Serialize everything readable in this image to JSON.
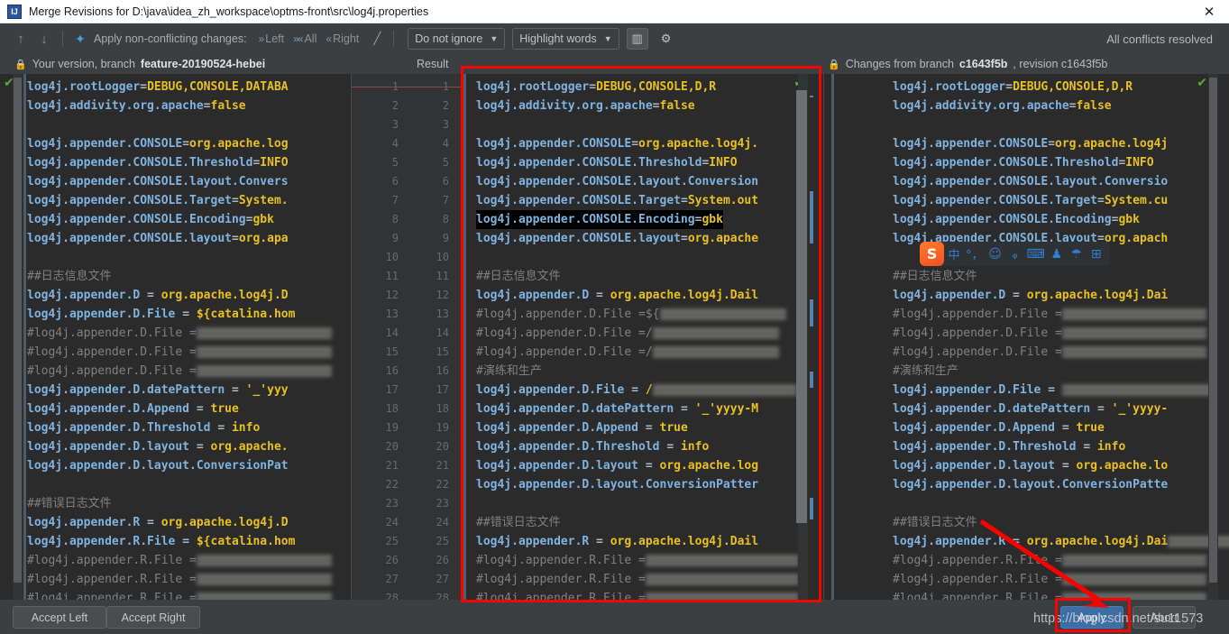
{
  "window": {
    "title": "Merge Revisions for D:\\java\\idea_zh_workspace\\optms-front\\src\\log4j.properties",
    "app_icon": "IJ",
    "close_icon": "✕"
  },
  "toolbar": {
    "prev_icon": "↑",
    "next_icon": "↓",
    "magic_icon": "✦",
    "apply_label": "Apply non-conflicting changes:",
    "left_label": "Left",
    "all_label": "All",
    "right_label": "Right",
    "left_icon": "»",
    "all_icon": "»«",
    "right_icon": "«",
    "wand_icon": "╱",
    "ignore_select": "Do not ignore",
    "highlight_select": "Highlight words",
    "caret_icon": "▼",
    "columns_icon": "▥",
    "gear_icon": "⚙",
    "status": "All conflicts resolved"
  },
  "headers": {
    "lock_icon": "🔒",
    "left_prefix": "Your version, branch ",
    "left_branch": "feature-20190524-hebei",
    "middle": "Result",
    "right_prefix": "Changes from branch ",
    "right_branch": "c1643f5b",
    "right_suffix": ", revision c1643f5b"
  },
  "editor": {
    "check_icon": "✔",
    "line_numbers_a": [
      "1",
      "2",
      "3",
      "4",
      "5",
      "6",
      "7",
      "8",
      "9",
      "10",
      "11",
      "12",
      "13",
      "14",
      "15",
      "16",
      "17",
      "18",
      "19",
      "20",
      "21",
      "22",
      "23",
      "24",
      "25",
      "26",
      "27",
      "28"
    ],
    "line_numbers_b": [
      "1",
      "2",
      "3",
      "4",
      "5",
      "6",
      "7",
      "8",
      "9",
      "10",
      "11",
      "12",
      "13",
      "14",
      "15",
      "16",
      "17",
      "18",
      "19",
      "20",
      "21",
      "22",
      "23",
      "24",
      "25",
      "26",
      "27",
      "28"
    ],
    "left_lines": [
      "log4j.rootLogger=DEBUG,CONSOLE,DATABA",
      "log4j.addivity.org.apache=false",
      "",
      "log4j.appender.CONSOLE=org.apache.log",
      "log4j.appender.CONSOLE.Threshold=INFO",
      "log4j.appender.CONSOLE.layout.Convers",
      "log4j.appender.CONSOLE.Target=System.",
      "log4j.appender.CONSOLE.Encoding=gbk",
      "log4j.appender.CONSOLE.layout=org.apa",
      "",
      "##日志信息文件",
      "log4j.appender.D = org.apache.log4j.D",
      "log4j.appender.D.File =${catalina.hom",
      "#log4j.appender.D.File =",
      "#log4j.appender.D.File =",
      "#log4j.appender.D.File =",
      "log4j.appender.D.datePattern = '_'yyy",
      "log4j.appender.D.Append = true",
      "log4j.appender.D.Threshold = info",
      "log4j.appender.D.layout = org.apache.",
      "log4j.appender.D.layout.ConversionPat",
      "",
      "##错误日志文件",
      "log4j.appender.R = org.apache.log4j.D",
      "log4j.appender.R.File =${catalina.hom",
      "#log4j.appender.R.File =",
      "#log4j.appender.R.File =",
      "#log4j.appender.R.File ="
    ],
    "middle_lines": [
      "log4j.rootLogger=DEBUG,CONSOLE,D,R",
      "log4j.addivity.org.apache=false",
      "",
      "log4j.appender.CONSOLE=org.apache.log4j.",
      "log4j.appender.CONSOLE.Threshold=INFO",
      "log4j.appender.CONSOLE.layout.Conversion",
      "log4j.appender.CONSOLE.Target=System.out",
      "log4j.appender.CONSOLE.Encoding=gbk",
      "log4j.appender.CONSOLE.layout=org.apache",
      "",
      "##日志信息文件",
      "log4j.appender.D = org.apache.log4j.Dail",
      "#log4j.appender.D.File =${",
      "#log4j.appender.D.File =/",
      "#log4j.appender.D.File =/",
      "#演练和生产",
      "log4j.appender.D.File =/",
      "log4j.appender.D.datePattern = '_'yyyy-M",
      "log4j.appender.D.Append = true",
      "log4j.appender.D.Threshold = info",
      "log4j.appender.D.layout = org.apache.log",
      "log4j.appender.D.layout.ConversionPatter",
      "",
      "##错误日志文件",
      "log4j.appender.R = org.apache.log4j.Dail",
      "#log4j.appender.R.File =",
      "#log4j.appender.R.File =",
      "#log4j.appender.R.File ="
    ],
    "right_lines": [
      "log4j.rootLogger=DEBUG,CONSOLE,D,R",
      "log4j.addivity.org.apache=false",
      "",
      "log4j.appender.CONSOLE=org.apache.log4j",
      "log4j.appender.CONSOLE.Threshold=INFO",
      "log4j.appender.CONSOLE.layout.Conversio",
      "log4j.appender.CONSOLE.Target=System.cu",
      "log4j.appender.CONSOLE.Encoding=gbk",
      "log4j.appender.CONSOLE.layout=org.apach",
      "",
      "##日志信息文件",
      "log4j.appender.D = org.apache.log4j.Dai",
      "#log4j.appender.D.File =",
      "#log4j.appender.D.File =",
      "#log4j.appender.D.File =",
      "#演练和生产",
      "log4j.appender.D.File =",
      "log4j.appender.D.datePattern = '_'yyyy-",
      "log4j.appender.D.Append = true",
      "log4j.appender.D.Threshold = info",
      "log4j.appender.D.layout = org.apache.lo",
      "log4j.appender.D.layout.ConversionPatte",
      "",
      "##错误日志文件",
      "log4j.appender.R = org.apache.log4j.Dai",
      "#log4j.appender.R.File =",
      "#log4j.appender.R.File =",
      "#log4j.appender.R.File ="
    ],
    "cursor_line_text": "log4j.appender.CONSOLE.Encoding=gbk"
  },
  "ime": {
    "logo": "S",
    "mode": "中",
    "punct": "°，",
    "emoji": "☺",
    "mic": "ᵩ",
    "keyboard": "⌨",
    "calendar": "♟",
    "skin": "☂",
    "grid": "⊞"
  },
  "bottom": {
    "accept_left": "Accept Left",
    "accept_right": "Accept Right",
    "apply": "Apply",
    "abort": "Abort",
    "watermark": "https://blog.csdn.net/su11573"
  },
  "colors": {
    "accent_blue": "#3c6ea5",
    "annotation_red": "#ff0000",
    "key_blue": "#7fb3e0",
    "value_yellow": "#e8c022",
    "comment_gray": "#808080",
    "editor_bg": "#2b2b2b",
    "chrome_bg": "#3c3f41",
    "ok_green": "#5aa832"
  }
}
